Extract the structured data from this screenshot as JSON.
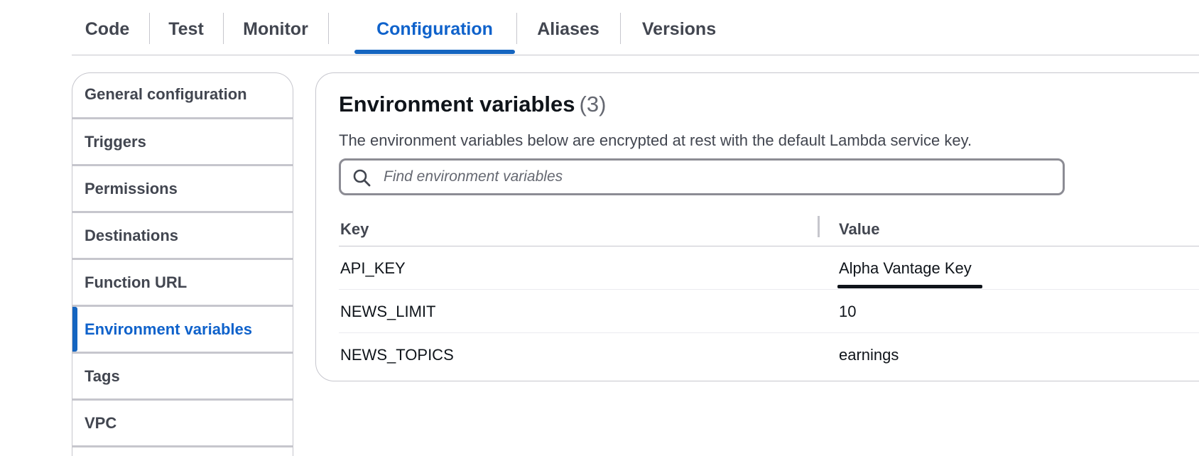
{
  "tabs": [
    {
      "label": "Code"
    },
    {
      "label": "Test"
    },
    {
      "label": "Monitor"
    },
    {
      "label": "Configuration",
      "active": true
    },
    {
      "label": "Aliases"
    },
    {
      "label": "Versions"
    }
  ],
  "sidebar": {
    "items": [
      {
        "label": "General configuration"
      },
      {
        "label": "Triggers"
      },
      {
        "label": "Permissions"
      },
      {
        "label": "Destinations"
      },
      {
        "label": "Function URL"
      },
      {
        "label": "Environment variables",
        "active": true
      },
      {
        "label": "Tags"
      },
      {
        "label": "VPC"
      }
    ]
  },
  "panel": {
    "title": "Environment variables",
    "count": "(3)",
    "description": "The environment variables below are encrypted at rest with the default Lambda service key.",
    "search": {
      "placeholder": "Find environment variables",
      "value": ""
    },
    "table": {
      "headers": {
        "key": "Key",
        "value": "Value"
      },
      "rows": [
        {
          "key": "API_KEY",
          "value": "Alpha Vantage Key"
        },
        {
          "key": "NEWS_LIMIT",
          "value": "10"
        },
        {
          "key": "NEWS_TOPICS",
          "value": "earnings"
        }
      ]
    }
  },
  "colors": {
    "accent": "#0f62cb",
    "text": "#0f141a",
    "muted": "#424650",
    "border": "#c6c6cd"
  },
  "icons": {
    "search": "search-icon"
  }
}
